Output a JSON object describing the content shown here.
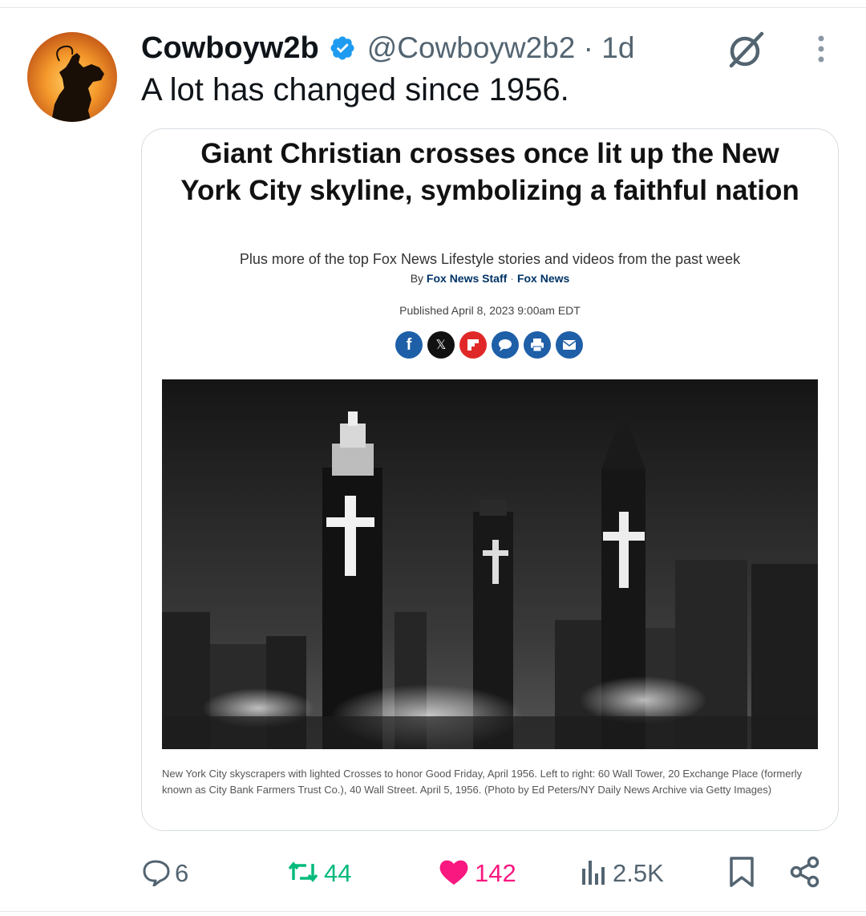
{
  "colors": {
    "verified": "#1d9bf0",
    "handle_gray": "#536471",
    "retweet_green": "#00ba7c",
    "like_pink": "#f91880",
    "action_gray": "#536471"
  },
  "tweet": {
    "display_name": "Cowboyw2b",
    "handle": "@Cowboyw2b2",
    "time": "1d",
    "text": "A lot has changed since 1956.",
    "avatar_icon": "cowboy-silhouette-avatar",
    "header_icons": [
      "verified-badge-icon",
      "hidden-reply-icon",
      "more-icon"
    ]
  },
  "article": {
    "headline": "Giant Christian crosses once lit up the New York City skyline, symbolizing a faithful nation",
    "subheadline": "Plus more of the top Fox News Lifestyle stories and videos from the past week",
    "by_prefix": "By",
    "author": "Fox News Staff",
    "outlet": "Fox News",
    "published": "Published April 8, 2023 9:00am EDT",
    "share_buttons": [
      {
        "name": "facebook-share-icon",
        "glyph": "f",
        "color": "#1e5fa8"
      },
      {
        "name": "x-share-icon",
        "glyph": "𝕏",
        "color": "#111111"
      },
      {
        "name": "flipboard-share-icon",
        "glyph": "",
        "color": "#e12828"
      },
      {
        "name": "comments-icon",
        "glyph": "",
        "color": "#1e5fa8"
      },
      {
        "name": "print-icon",
        "glyph": "",
        "color": "#1e5fa8"
      },
      {
        "name": "email-icon",
        "glyph": "",
        "color": "#1e5fa8"
      }
    ],
    "photo_icon": "nyc-skyline-crosses-photo",
    "caption": "New York City skyscrapers with lighted Crosses to honor Good Friday, April 1956. Left to right: 60 Wall Tower, 20 Exchange Place (formerly known as City Bank Farmers Trust Co.), 40 Wall Street. April 5, 1956. (Photo by Ed Peters/NY Daily News Archive via Getty Images)"
  },
  "actions": {
    "replies": "6",
    "retweets": "44",
    "likes": "142",
    "views": "2.5K"
  }
}
